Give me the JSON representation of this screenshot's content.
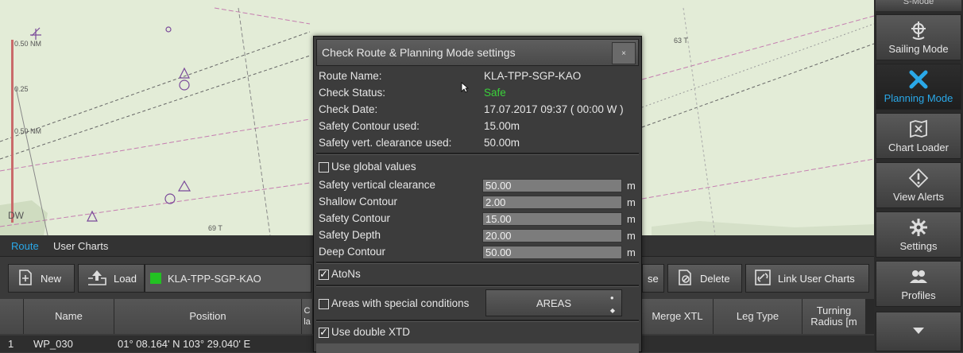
{
  "chart": {
    "scale_labels": [
      "0.50 NM",
      "0.25",
      "0.50 NM"
    ],
    "marks": [
      "DW",
      "69 T",
      "63 T"
    ]
  },
  "sidebar": {
    "items": [
      {
        "label": "Sailing Mode",
        "icon": "ship-wheel-icon",
        "active": false
      },
      {
        "label": "Planning Mode",
        "icon": "planning-tools-icon",
        "active": true
      },
      {
        "label": "Chart Loader",
        "icon": "chart-loader-icon",
        "active": false
      },
      {
        "label": "View Alerts",
        "icon": "alert-icon",
        "active": false
      },
      {
        "label": "Settings",
        "icon": "gear-icon",
        "active": false
      },
      {
        "label": "Profiles",
        "icon": "profiles-icon",
        "active": false
      }
    ],
    "top_partial": "S-Mode"
  },
  "bottom": {
    "tabs": [
      "Route",
      "User Charts"
    ],
    "toolbar": {
      "new_label": "New",
      "load_label": "Load",
      "route_name": "KLA-TPP-SGP-KAO",
      "partial_label": "se",
      "delete_label": "Delete",
      "link_label": "Link User Charts"
    },
    "columns": [
      "Name",
      "Position",
      "C la",
      "Merge XTL",
      "Leg Type",
      "Turning Radius [m"
    ],
    "rows": [
      {
        "index": "1",
        "name": "WP_030",
        "position": "01° 08.164' N 103° 29.040' E"
      }
    ]
  },
  "dialog": {
    "title": "Check Route & Planning Mode settings",
    "close": "×",
    "info": [
      {
        "label": "Route Name:",
        "value": "KLA-TPP-SGP-KAO"
      },
      {
        "label": "Check Status:",
        "value": "Safe"
      },
      {
        "label": "Check Date:",
        "value": "17.07.2017 09:37 ( 00:00 W )"
      },
      {
        "label": "Safety Contour used:",
        "value": "15.00m"
      },
      {
        "label": "Safety vert. clearance used:",
        "value": "50.00m"
      }
    ],
    "use_global_label": "Use global values",
    "use_global_checked": false,
    "fields": [
      {
        "label": "Safety vertical clearance",
        "value": "50.00",
        "unit": "m"
      },
      {
        "label": "Shallow Contour",
        "value": "2.00",
        "unit": "m"
      },
      {
        "label": "Safety Contour",
        "value": "15.00",
        "unit": "m"
      },
      {
        "label": "Safety Depth",
        "value": "20.00",
        "unit": "m"
      },
      {
        "label": "Deep Contour",
        "value": "50.00",
        "unit": "m"
      }
    ],
    "atons_label": "AtoNs",
    "atons_checked": true,
    "areas_label": "Areas with special conditions",
    "areas_checked": false,
    "areas_button": "AREAS",
    "double_xtd_label": "Use double XTD",
    "double_xtd_checked": true
  },
  "colors": {
    "safe": "#3ad13a",
    "accent": "#2aa8e8",
    "route_marker": "#22c222"
  }
}
